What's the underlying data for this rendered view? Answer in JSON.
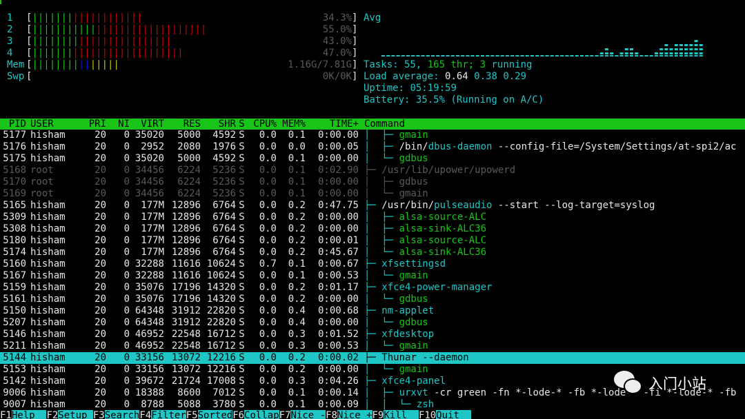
{
  "meters": {
    "cpus": [
      {
        "label": "1",
        "value": "34.3%",
        "green": 7,
        "red": 12
      },
      {
        "label": "2",
        "value": "55.0%",
        "green": 11,
        "red": 19
      },
      {
        "label": "3",
        "value": "43.0%",
        "green": 8,
        "red": 16
      },
      {
        "label": "4",
        "value": "47.0%",
        "green": 7,
        "red": 19
      }
    ],
    "mem": {
      "label": "Mem",
      "value": "1.16G/7.81G",
      "green": 8,
      "blue": 2,
      "yellow": 5
    },
    "swp": {
      "label": "Swp",
      "value": "0K/0K"
    }
  },
  "summary": {
    "graph_label": "Avg",
    "tasks_label": "Tasks: ",
    "tasks": "55",
    "sep": ", ",
    "threads": "165",
    "thr_label": " thr; ",
    "running": "3",
    "running_label": " running",
    "load_label": "Load average: ",
    "load1": "0.64",
    "load5": "0.38",
    "load15": "0.29",
    "uptime_label": "Uptime: ",
    "uptime": "05:19:59",
    "battery_label": "Battery: ",
    "battery": "35.5% (Running on A/C)"
  },
  "graph_history": [
    0,
    0,
    0,
    0,
    0,
    0,
    0,
    0,
    0,
    0,
    0,
    0,
    0,
    0,
    0,
    0,
    0,
    0,
    0,
    0,
    0,
    0,
    0,
    0,
    0,
    0,
    0,
    0,
    0,
    0,
    0,
    0,
    0,
    0,
    0,
    0,
    0,
    0,
    0,
    0,
    0,
    0,
    0,
    0,
    1,
    2,
    1,
    0,
    1,
    2,
    2,
    1,
    0,
    0,
    0,
    1,
    2,
    3,
    2,
    3,
    3,
    3,
    3,
    4,
    3
  ],
  "table": {
    "headers": {
      "pid": "PID",
      "user": "USER",
      "pri": "PRI",
      "ni": "NI",
      "virt": "VIRT",
      "res": "RES",
      "shr": "SHR",
      "s": "S",
      "cpu": "CPU%",
      "mem": "MEM%",
      "time": "TIME+",
      "cmd": "Command"
    },
    "rows": [
      {
        "pid": "5177",
        "user": "hisham",
        "pri": "20",
        "ni": "0",
        "virt": "35020",
        "res": "5000",
        "shr": "4592",
        "s": "S",
        "cpu": "0.0",
        "mem": "0.1",
        "time": "0:00.00",
        "tree": "│  ├─ ",
        "name": "gmain",
        "args": "",
        "kind": "thread"
      },
      {
        "pid": "5176",
        "user": "hisham",
        "pri": "20",
        "ni": "0",
        "virt": "2952",
        "res": "2080",
        "shr": "1976",
        "s": "S",
        "cpu": "0.0",
        "mem": "0.0",
        "time": "0:00.05",
        "tree": "│  ├─ ",
        "prefix": "/bin/",
        "name": "dbus-daemon",
        "args": " --config-file=/System/Settings/at-spi2/ac",
        "kind": "proc"
      },
      {
        "pid": "5175",
        "user": "hisham",
        "pri": "20",
        "ni": "0",
        "virt": "35020",
        "res": "5000",
        "shr": "4592",
        "s": "S",
        "cpu": "0.0",
        "mem": "0.1",
        "time": "0:00.00",
        "tree": "│  └─ ",
        "name": "gdbus",
        "args": "",
        "kind": "thread"
      },
      {
        "pid": "5168",
        "user": "root",
        "pri": "20",
        "ni": "0",
        "virt": "34456",
        "res": "6224",
        "shr": "5236",
        "s": "S",
        "cpu": "0.0",
        "mem": "0.1",
        "time": "0:02.90",
        "tree": "├─ ",
        "name": "/usr/lib/upower/upowerd",
        "args": "",
        "kind": "dim"
      },
      {
        "pid": "5170",
        "user": "root",
        "pri": "20",
        "ni": "0",
        "virt": "34456",
        "res": "6224",
        "shr": "5236",
        "s": "S",
        "cpu": "0.0",
        "mem": "0.1",
        "time": "0:00.00",
        "tree": "│  ├─ ",
        "name": "gdbus",
        "args": "",
        "kind": "dim"
      },
      {
        "pid": "5169",
        "user": "root",
        "pri": "20",
        "ni": "0",
        "virt": "34456",
        "res": "6224",
        "shr": "5236",
        "s": "S",
        "cpu": "0.0",
        "mem": "0.1",
        "time": "0:00.00",
        "tree": "│  └─ ",
        "name": "gmain",
        "args": "",
        "kind": "dim"
      },
      {
        "pid": "5165",
        "user": "hisham",
        "pri": "20",
        "ni": "0",
        "virt": "177M",
        "res": "12896",
        "shr": "6764",
        "s": "S",
        "cpu": "0.0",
        "mem": "0.2",
        "time": "0:47.75",
        "tree": "├─ ",
        "prefix": "/usr/bin/",
        "name": "pulseaudio",
        "args": " --start --log-target=syslog",
        "kind": "proc"
      },
      {
        "pid": "5309",
        "user": "hisham",
        "pri": "20",
        "ni": "0",
        "virt": "177M",
        "res": "12896",
        "shr": "6764",
        "s": "S",
        "cpu": "0.0",
        "mem": "0.2",
        "time": "0:00.00",
        "tree": "│  ├─ ",
        "name": "alsa-source-ALC",
        "args": "",
        "kind": "thread"
      },
      {
        "pid": "5308",
        "user": "hisham",
        "pri": "20",
        "ni": "0",
        "virt": "177M",
        "res": "12896",
        "shr": "6764",
        "s": "S",
        "cpu": "0.0",
        "mem": "0.2",
        "time": "0:00.00",
        "tree": "│  ├─ ",
        "name": "alsa-sink-ALC36",
        "args": "",
        "kind": "thread"
      },
      {
        "pid": "5180",
        "user": "hisham",
        "pri": "20",
        "ni": "0",
        "virt": "177M",
        "res": "12896",
        "shr": "6764",
        "s": "S",
        "cpu": "0.0",
        "mem": "0.2",
        "time": "0:00.01",
        "tree": "│  ├─ ",
        "name": "alsa-source-ALC",
        "args": "",
        "kind": "thread"
      },
      {
        "pid": "5174",
        "user": "hisham",
        "pri": "20",
        "ni": "0",
        "virt": "177M",
        "res": "12896",
        "shr": "6764",
        "s": "S",
        "cpu": "0.0",
        "mem": "0.2",
        "time": "0:45.67",
        "tree": "│  └─ ",
        "name": "alsa-sink-ALC36",
        "args": "",
        "kind": "thread"
      },
      {
        "pid": "5160",
        "user": "hisham",
        "pri": "20",
        "ni": "0",
        "virt": "32288",
        "res": "11616",
        "shr": "10624",
        "s": "S",
        "cpu": "0.7",
        "mem": "0.1",
        "time": "0:00.67",
        "tree": "├─ ",
        "name": "xfsettingsd",
        "args": "",
        "kind": "proc"
      },
      {
        "pid": "5167",
        "user": "hisham",
        "pri": "20",
        "ni": "0",
        "virt": "32288",
        "res": "11616",
        "shr": "10624",
        "s": "S",
        "cpu": "0.0",
        "mem": "0.1",
        "time": "0:00.53",
        "tree": "│  └─ ",
        "name": "gmain",
        "args": "",
        "kind": "thread"
      },
      {
        "pid": "5159",
        "user": "hisham",
        "pri": "20",
        "ni": "0",
        "virt": "35076",
        "res": "17196",
        "shr": "14320",
        "s": "S",
        "cpu": "0.0",
        "mem": "0.2",
        "time": "0:01.17",
        "tree": "├─ ",
        "name": "xfce4-power-manager",
        "args": "",
        "kind": "proc"
      },
      {
        "pid": "5161",
        "user": "hisham",
        "pri": "20",
        "ni": "0",
        "virt": "35076",
        "res": "17196",
        "shr": "14320",
        "s": "S",
        "cpu": "0.0",
        "mem": "0.2",
        "time": "0:00.00",
        "tree": "│  └─ ",
        "name": "gdbus",
        "args": "",
        "kind": "thread"
      },
      {
        "pid": "5150",
        "user": "hisham",
        "pri": "20",
        "ni": "0",
        "virt": "64348",
        "res": "31912",
        "shr": "22820",
        "s": "S",
        "cpu": "0.0",
        "mem": "0.4",
        "time": "0:00.68",
        "tree": "├─ ",
        "name": "nm-applet",
        "args": "",
        "kind": "proc"
      },
      {
        "pid": "5207",
        "user": "hisham",
        "pri": "20",
        "ni": "0",
        "virt": "64348",
        "res": "31912",
        "shr": "22820",
        "s": "S",
        "cpu": "0.0",
        "mem": "0.4",
        "time": "0:00.00",
        "tree": "│  └─ ",
        "name": "gdbus",
        "args": "",
        "kind": "thread"
      },
      {
        "pid": "5146",
        "user": "hisham",
        "pri": "20",
        "ni": "0",
        "virt": "46952",
        "res": "22548",
        "shr": "16712",
        "s": "S",
        "cpu": "0.0",
        "mem": "0.3",
        "time": "0:01.52",
        "tree": "├─ ",
        "name": "xfdesktop",
        "args": "",
        "kind": "proc"
      },
      {
        "pid": "5211",
        "user": "hisham",
        "pri": "20",
        "ni": "0",
        "virt": "46952",
        "res": "22548",
        "shr": "16712",
        "s": "S",
        "cpu": "0.0",
        "mem": "0.3",
        "time": "0:00.53",
        "tree": "│  └─ ",
        "name": "gmain",
        "args": "",
        "kind": "thread"
      },
      {
        "pid": "5144",
        "user": "hisham",
        "pri": "20",
        "ni": "0",
        "virt": "33156",
        "res": "13072",
        "shr": "12216",
        "s": "S",
        "cpu": "0.0",
        "mem": "0.2",
        "time": "0:00.02",
        "tree": "├─ ",
        "name": "Thunar",
        "args": " --daemon",
        "kind": "selected"
      },
      {
        "pid": "5153",
        "user": "hisham",
        "pri": "20",
        "ni": "0",
        "virt": "33156",
        "res": "13072",
        "shr": "12216",
        "s": "S",
        "cpu": "0.0",
        "mem": "0.2",
        "time": "0:00.00",
        "tree": "│  └─ ",
        "name": "gmain",
        "args": "",
        "kind": "thread"
      },
      {
        "pid": "5142",
        "user": "hisham",
        "pri": "20",
        "ni": "0",
        "virt": "39672",
        "res": "21724",
        "shr": "17008",
        "s": "S",
        "cpu": "0.0",
        "mem": "0.3",
        "time": "0:04.26",
        "tree": "├─ ",
        "name": "xfce4-panel",
        "args": "",
        "kind": "proc"
      },
      {
        "pid": "9006",
        "user": "hisham",
        "pri": "20",
        "ni": "0",
        "virt": "18388",
        "res": "8600",
        "shr": "7012",
        "s": "S",
        "cpu": "0.0",
        "mem": "0.1",
        "time": "0:00.14",
        "tree": "│  ├─ ",
        "name": "urxvt",
        "args": " -cr green -fn *-lode-* -fb *-lode-* -fi *-lode-* -fb",
        "kind": "proc"
      },
      {
        "pid": "9007",
        "user": "hisham",
        "pri": "20",
        "ni": "0",
        "virt": "8788",
        "res": "5088",
        "shr": "3780",
        "s": "S",
        "cpu": "0.0",
        "mem": "0.1",
        "time": "0:00.09",
        "tree": "│  │  └─ ",
        "name": "zsh",
        "args": "",
        "kind": "proc"
      }
    ]
  },
  "footer": [
    {
      "key": "F1",
      "label": "Help  "
    },
    {
      "key": "F2",
      "label": "Setup "
    },
    {
      "key": "F3",
      "label": "Search"
    },
    {
      "key": "F4",
      "label": "Filter"
    },
    {
      "key": "F5",
      "label": "Sorted"
    },
    {
      "key": "F6",
      "label": "Collap"
    },
    {
      "key": "F7",
      "label": "Nice -"
    },
    {
      "key": "F8",
      "label": "Nice +"
    },
    {
      "key": "F9",
      "label": "Kill  "
    },
    {
      "key": "F10",
      "label": "Quit  "
    }
  ],
  "watermark": {
    "text": "入门小站"
  }
}
